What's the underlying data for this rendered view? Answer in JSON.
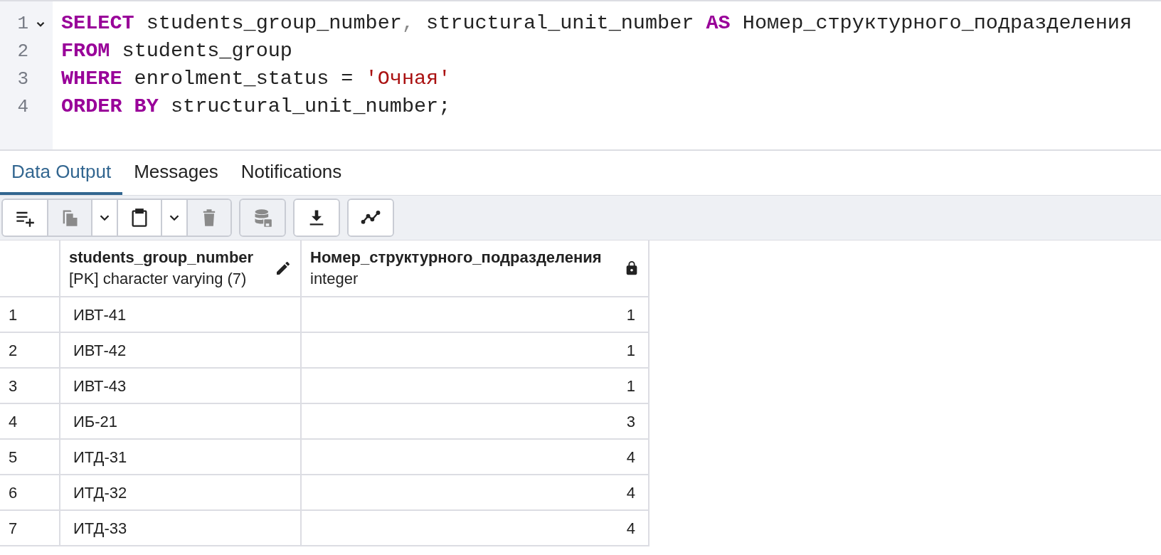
{
  "editor": {
    "lines": [
      {
        "number": "1",
        "foldable": true,
        "tokens": [
          {
            "kind": "keyword",
            "text": "SELECT"
          },
          {
            "kind": "plain",
            "text": " students_group_number"
          },
          {
            "kind": "punct",
            "text": ","
          },
          {
            "kind": "plain",
            "text": " structural_unit_number "
          },
          {
            "kind": "keyword",
            "text": "AS"
          },
          {
            "kind": "plain",
            "text": " Номер_структурного_подразделения"
          }
        ]
      },
      {
        "number": "2",
        "foldable": false,
        "tokens": [
          {
            "kind": "keyword",
            "text": "FROM"
          },
          {
            "kind": "plain",
            "text": " students_group"
          }
        ]
      },
      {
        "number": "3",
        "foldable": false,
        "tokens": [
          {
            "kind": "keyword",
            "text": "WHERE"
          },
          {
            "kind": "plain",
            "text": " enrolment_status = "
          },
          {
            "kind": "string",
            "text": "'Очная'"
          }
        ]
      },
      {
        "number": "4",
        "foldable": false,
        "tokens": [
          {
            "kind": "keyword",
            "text": "ORDER BY"
          },
          {
            "kind": "plain",
            "text": " structural_unit_number;"
          }
        ]
      }
    ]
  },
  "tabs": [
    {
      "label": "Data Output",
      "selected": true
    },
    {
      "label": "Messages",
      "selected": false
    },
    {
      "label": "Notifications",
      "selected": false
    }
  ],
  "toolbar": [
    {
      "group": [
        {
          "kind": "add-row",
          "disabled": false
        },
        {
          "kind": "copy",
          "disabled": true
        },
        {
          "kind": "caret",
          "disabled": false
        },
        {
          "kind": "paste",
          "disabled": false
        },
        {
          "kind": "caret",
          "disabled": false
        },
        {
          "kind": "delete",
          "disabled": true
        }
      ]
    },
    {
      "group": [
        {
          "kind": "save",
          "disabled": true
        }
      ]
    },
    {
      "group": [
        {
          "kind": "download",
          "disabled": false
        }
      ]
    },
    {
      "group": [
        {
          "kind": "graph",
          "disabled": false
        }
      ]
    }
  ],
  "table": {
    "columns": [
      {
        "name": "students_group_number",
        "type": "[PK] character varying (7)",
        "editable": true
      },
      {
        "name": "Номер_структурного_подразделения",
        "type": "integer",
        "editable": false
      }
    ],
    "rows": [
      {
        "number": "1",
        "cells": [
          "ИВТ-41",
          "1"
        ]
      },
      {
        "number": "2",
        "cells": [
          "ИВТ-42",
          "1"
        ]
      },
      {
        "number": "3",
        "cells": [
          "ИВТ-43",
          "1"
        ]
      },
      {
        "number": "4",
        "cells": [
          "ИБ-21",
          "3"
        ]
      },
      {
        "number": "5",
        "cells": [
          "ИТД-31",
          "4"
        ]
      },
      {
        "number": "6",
        "cells": [
          "ИТД-32",
          "4"
        ]
      },
      {
        "number": "7",
        "cells": [
          "ИТД-33",
          "4"
        ]
      }
    ]
  }
}
